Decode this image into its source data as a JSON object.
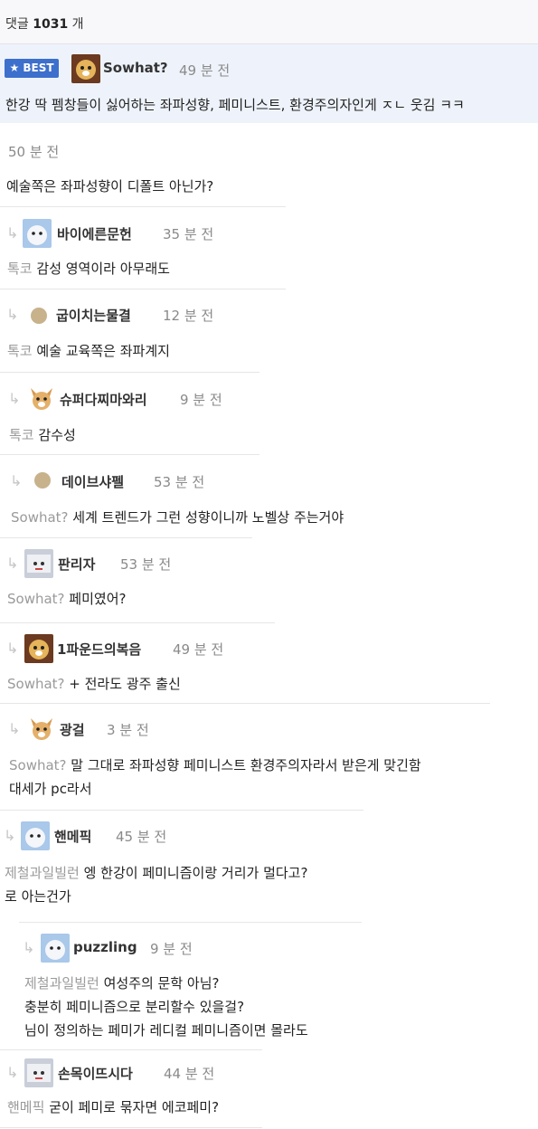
{
  "header": {
    "prefix": "댓글",
    "count": "1031",
    "suffix": "개"
  },
  "best": {
    "badge": "BEST",
    "name": "Sowhat?",
    "time": "49 분 전",
    "text": "한강 딱 펨창들이 싫어하는 좌파성향, 페미니스트, 환경주의자인게 ㅈㄴ 웃김 ㅋㅋ"
  },
  "comments": [
    {
      "time": "50 분 전",
      "text": "예술쪽은 좌파성향이 디폴트 아닌가?"
    },
    {
      "name": "바이에른문헌",
      "time": "35 분 전",
      "ref": "톡코",
      "text": "감성 영역이라 아무래도"
    },
    {
      "name": "굽이치는물결",
      "time": "12 분 전",
      "ref": "톡코",
      "text": "예술 교육쪽은 좌파계지"
    },
    {
      "name": "슈퍼다찌마와리",
      "time": "9 분 전",
      "ref": "톡코",
      "text": "감수성"
    },
    {
      "name": "데이브샤펠",
      "time": "53 분 전",
      "ref": "Sowhat?",
      "text": "세계 트렌드가 그런 성향이니까 노벨상 주는거야"
    },
    {
      "name": "판리자",
      "time": "53 분 전",
      "ref": "Sowhat?",
      "text": "페미였어?"
    },
    {
      "name": "1파운드의복음",
      "time": "49 분 전",
      "ref": "Sowhat?",
      "text": "+ 전라도 광주 출신"
    },
    {
      "name": "광걸",
      "time": "3 분 전",
      "ref": "Sowhat?",
      "text": "말 그대로 좌파성향 페미니스트 환경주의자라서 받은게 맞긴함",
      "text2": "대세가 pc라서"
    },
    {
      "name": "핸메픽",
      "time": "45 분 전",
      "ref": "제철과일빌런",
      "text": "엥 한강이 페미니즘이랑 거리가 멀다고?",
      "text2": "로 아는건가"
    },
    {
      "name": "puzzling",
      "time": "9 분 전",
      "ref": "제철과일빌런",
      "text": "여성주의 문학 아님?",
      "text2": "충분히 페미니즘으로 분리할수 있을걸?",
      "text3": "님이 정의하는 페미가 레디컬 페미니즘이면 몰라도"
    },
    {
      "name": "손목이뜨시다",
      "time": "44 분 전",
      "ref": "핸메픽",
      "text": "굳이 페미로 묶자면 에코페미?"
    }
  ]
}
